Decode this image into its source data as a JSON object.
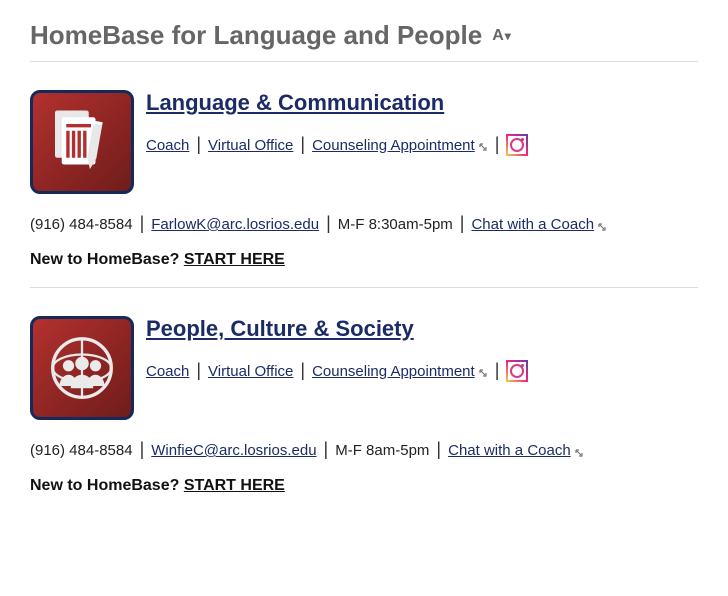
{
  "heading": "HomeBase for Language and People",
  "font_reduce_label": "A",
  "sections": [
    {
      "icon": "document",
      "title": "Language & Communication",
      "links": {
        "coach": "Coach",
        "virtual_office": "Virtual Office",
        "counseling": "Counseling Appointment"
      },
      "phone": "(916) 484-8584",
      "email": "FarlowK@arc.losrios.edu",
      "hours": "M-F 8:30am-5pm",
      "chat": "Chat with a Coach",
      "new_prefix": "New to HomeBase? ",
      "start": "START HERE"
    },
    {
      "icon": "people",
      "title": "People, Culture & Society",
      "links": {
        "coach": "Coach",
        "virtual_office": "Virtual Office",
        "counseling": "Counseling Appointment"
      },
      "phone": "(916) 484-8584",
      "email": "WinfieC@arc.losrios.edu",
      "hours": "M-F 8am-5pm",
      "chat": "Chat with a Coach",
      "new_prefix": "New to HomeBase? ",
      "start": "START HERE"
    }
  ]
}
